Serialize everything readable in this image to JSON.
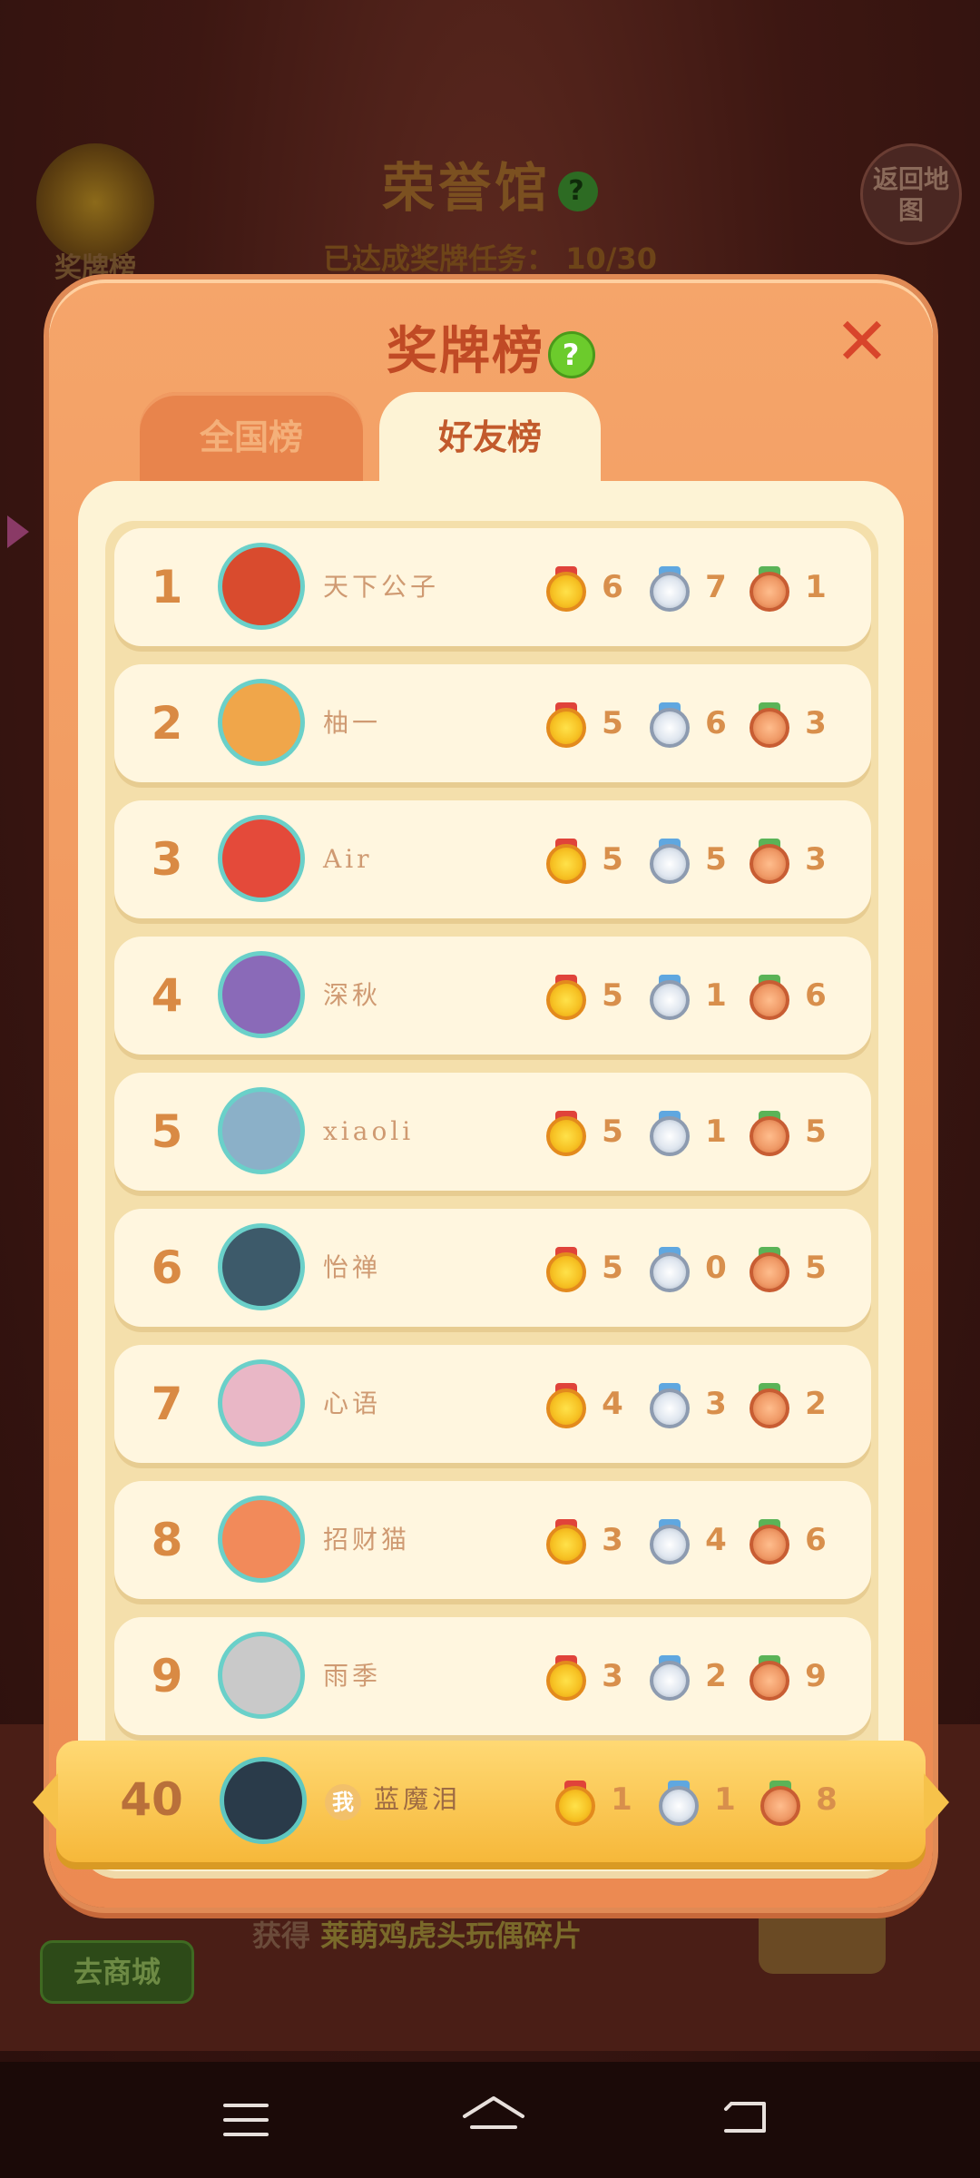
{
  "background": {
    "title": "荣誉馆",
    "progress_label": "已达成奖牌任务：",
    "progress_value": "10/30",
    "medal_button_label": "奖牌榜",
    "return_button_label": "返回地图",
    "shop_button_label": "去商城",
    "reward_prefix": "获得",
    "reward_item": "莱萌鸡虎头玩偶碎片"
  },
  "modal": {
    "title": "奖牌榜",
    "help_glyph": "?",
    "close_glyph": "✕",
    "tabs": [
      {
        "label": "全国榜",
        "active": false
      },
      {
        "label": "好友榜",
        "active": true
      }
    ]
  },
  "leaderboard": [
    {
      "rank": "1",
      "name": "天下公子",
      "gold": "6",
      "silver": "7",
      "bronze": "1"
    },
    {
      "rank": "2",
      "name": "柚一",
      "gold": "5",
      "silver": "6",
      "bronze": "3"
    },
    {
      "rank": "3",
      "name": "Air",
      "gold": "5",
      "silver": "5",
      "bronze": "3"
    },
    {
      "rank": "4",
      "name": "深秋",
      "gold": "5",
      "silver": "1",
      "bronze": "6"
    },
    {
      "rank": "5",
      "name": "xiaoli",
      "gold": "5",
      "silver": "1",
      "bronze": "5"
    },
    {
      "rank": "6",
      "name": "怡禅",
      "gold": "5",
      "silver": "0",
      "bronze": "5"
    },
    {
      "rank": "7",
      "name": "心语",
      "gold": "4",
      "silver": "3",
      "bronze": "2"
    },
    {
      "rank": "8",
      "name": "招财猫",
      "gold": "3",
      "silver": "4",
      "bronze": "6"
    },
    {
      "rank": "9",
      "name": "雨季",
      "gold": "3",
      "silver": "2",
      "bronze": "9"
    }
  ],
  "my_entry": {
    "rank": "40",
    "me_badge": "我",
    "name": "蓝魔泪",
    "gold": "1",
    "silver": "1",
    "bronze": "8"
  },
  "colors": {
    "modal_orange": "#ec8a52",
    "panel_cream": "#fdf3d5",
    "title_red": "#c04a25",
    "my_row_gold": "#f6b83a"
  }
}
